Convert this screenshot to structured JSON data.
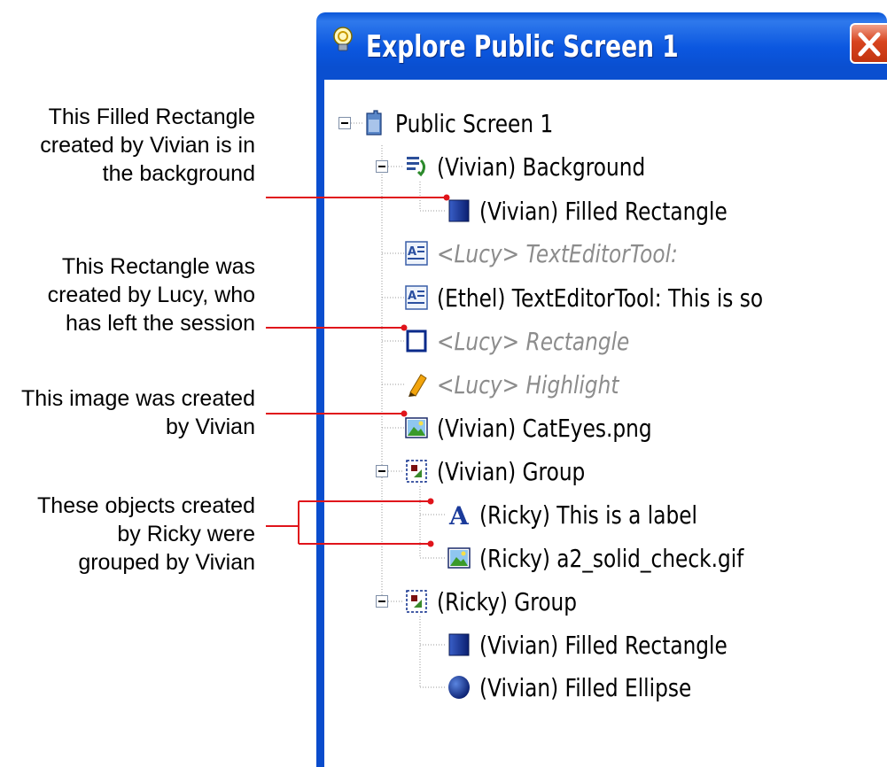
{
  "window": {
    "title": "Explore Public Screen 1",
    "close_label": "Close"
  },
  "tree": [
    {
      "id": "root",
      "label": "Public Screen 1",
      "icon": "screen-icon",
      "expanded": true,
      "ghost": false
    },
    {
      "id": "background",
      "label": "(Vivian) Background",
      "icon": "background-icon",
      "expanded": true,
      "ghost": false
    },
    {
      "id": "bg-filled-rect",
      "label": "(Vivian) Filled Rectangle",
      "icon": "filled-rectangle-icon",
      "ghost": false
    },
    {
      "id": "lucy-text",
      "label": "<Lucy> TextEditorTool:",
      "icon": "text-editor-icon",
      "ghost": true
    },
    {
      "id": "ethel-text",
      "label": "(Ethel) TextEditorTool: This is so",
      "icon": "text-editor-icon",
      "ghost": false
    },
    {
      "id": "lucy-rect",
      "label": "<Lucy> Rectangle",
      "icon": "rectangle-icon",
      "ghost": true
    },
    {
      "id": "lucy-highlight",
      "label": "<Lucy> Highlight",
      "icon": "highlight-icon",
      "ghost": true
    },
    {
      "id": "cateyes",
      "label": "(Vivian) CatEyes.png",
      "icon": "image-icon",
      "ghost": false
    },
    {
      "id": "vivian-group",
      "label": "(Vivian) Group",
      "icon": "group-icon",
      "expanded": true,
      "ghost": false
    },
    {
      "id": "ricky-label",
      "label": "(Ricky) This is a label",
      "icon": "label-icon",
      "ghost": false
    },
    {
      "id": "ricky-gif",
      "label": "(Ricky) a2_solid_check.gif",
      "icon": "image-icon",
      "ghost": false
    },
    {
      "id": "ricky-group",
      "label": "(Ricky) Group",
      "icon": "group-icon",
      "expanded": true,
      "ghost": false
    },
    {
      "id": "group-filled-rect",
      "label": "(Vivian) Filled Rectangle",
      "icon": "filled-rectangle-icon",
      "ghost": false
    },
    {
      "id": "group-filled-ellipse",
      "label": "(Vivian) Filled Ellipse",
      "icon": "filled-ellipse-icon",
      "ghost": false
    }
  ],
  "annotations": [
    {
      "lines": [
        "This Filled Rectangle",
        "created by Vivian is in",
        "the background"
      ]
    },
    {
      "lines": [
        "This Rectangle was",
        "created by Lucy,  who",
        "has left the session"
      ]
    },
    {
      "lines": [
        "This image was created",
        "by Vivian"
      ]
    },
    {
      "lines": [
        "These objects created",
        "by Ricky were",
        "grouped by Vivian"
      ]
    }
  ],
  "colors": {
    "titlebar": "#0a56d8",
    "connector": "#e0141b",
    "ghost_text": "#8c8c8c",
    "close_button": "#d8451f"
  }
}
